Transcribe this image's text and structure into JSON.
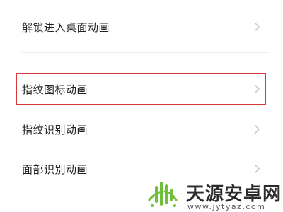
{
  "menu": {
    "items": [
      {
        "label": "解锁进入桌面动画",
        "icon": "chevron-right-icon"
      },
      {
        "label": "指纹图标动画",
        "icon": "chevron-right-icon",
        "highlighted": true
      },
      {
        "label": "指纹识别动画",
        "icon": "chevron-right-icon"
      },
      {
        "label": "面部识别动画",
        "icon": "chevron-right-icon"
      }
    ]
  },
  "watermark": {
    "title": "天源安卓网",
    "url": "www.jytyaz.com"
  },
  "colors": {
    "highlight": "#d8393b",
    "text": "#222222",
    "chevron": "#c2c2c2",
    "logo_green": "#6fbf3a"
  }
}
